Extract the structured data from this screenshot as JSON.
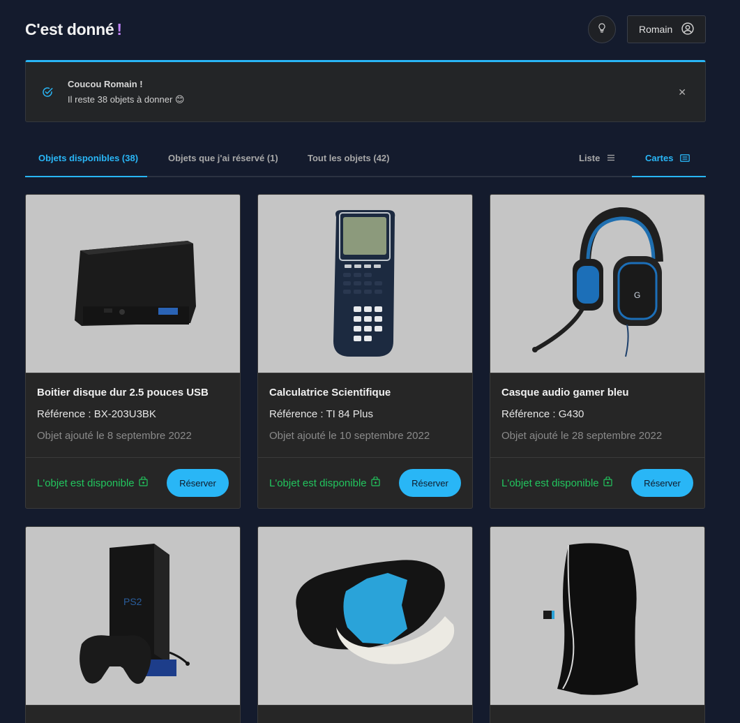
{
  "header": {
    "brand": "C'est donné",
    "brand_mark": "!",
    "bulb_icon": "lightbulb-icon",
    "user_name": "Romain",
    "user_icon": "user-circle-icon"
  },
  "alert": {
    "icon": "check-circle-icon",
    "title": "Coucou Romain !",
    "text": "Il reste 38 objets à donner 😊",
    "close_icon": "close-icon",
    "accent": "#29b6f6"
  },
  "tabs": {
    "available": "Objets disponibles (38)",
    "reserved": "Objets que j'ai réservé (1)",
    "all": "Tout les objets (42)",
    "list": "Liste",
    "cards": "Cartes"
  },
  "cards": [
    {
      "title": "Boitier disque dur 2.5 pouces USB",
      "reference": "Référence : BX-203U3BK",
      "date": "Objet ajouté le 8 septembre 2022",
      "status": "L'objet est disponible",
      "button": "Réserver"
    },
    {
      "title": "Calculatrice Scientifique",
      "reference": "Référence : TI 84 Plus",
      "date": "Objet ajouté le 10 septembre 2022",
      "status": "L'objet est disponible",
      "button": "Réserver"
    },
    {
      "title": "Casque audio gamer bleu",
      "reference": "Référence : G430",
      "date": "Objet ajouté le 28 septembre 2022",
      "status": "L'objet est disponible",
      "button": "Réserver"
    }
  ],
  "colors": {
    "accent": "#29b6f6",
    "available": "#22c55e",
    "background": "#141b2d",
    "card": "#262626"
  }
}
